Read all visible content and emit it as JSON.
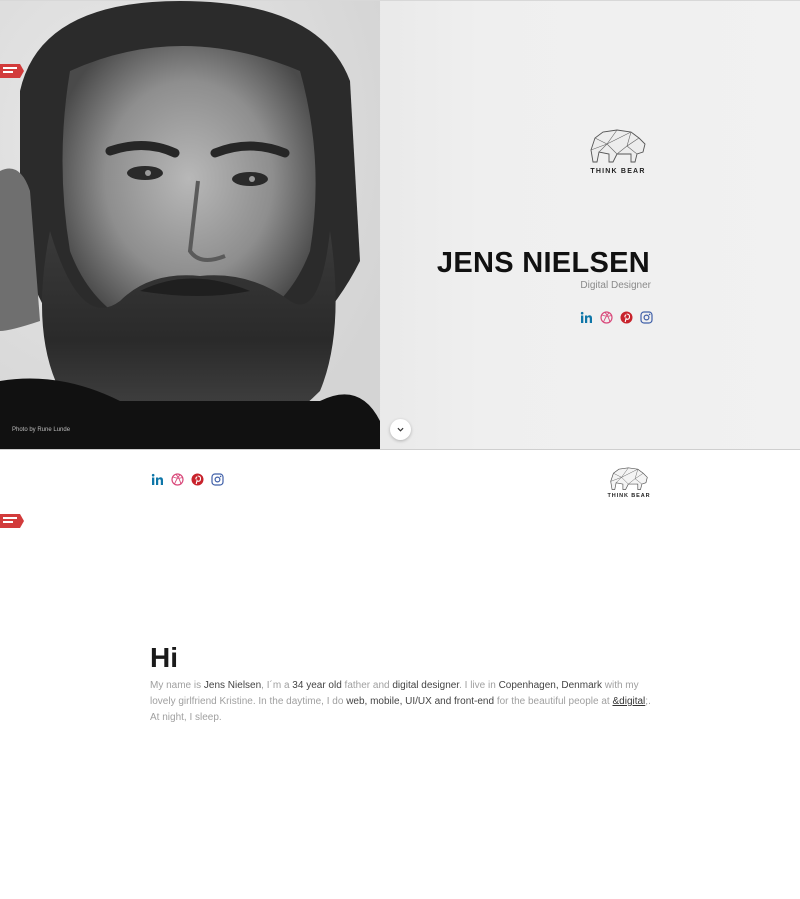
{
  "hero": {
    "name": "JENS NIELSEN",
    "role": "Digital Designer",
    "photo_credit": "Photo by Rune Lunde",
    "brand_label": "THINK BEAR"
  },
  "top_bar": {
    "brand_label": "THINK BEAR"
  },
  "social_links": [
    "linkedin",
    "dribbble",
    "pinterest",
    "instagram"
  ],
  "colors": {
    "linkedin": "#0e76a8",
    "dribbble": "#d9487a",
    "pinterest": "#c8232c",
    "instagram": "#3f5fa8",
    "award_red": "#d23b3b"
  },
  "intro": {
    "heading": "Hi",
    "p1": "My name is ",
    "name": "Jens Nielsen",
    "p2": ", I´m a ",
    "age": "34 year old",
    "p3": " father and ",
    "job": "digital designer",
    "p4": ". I live in ",
    "city": "Copenhagen, Denmark",
    "p5": " with my lovely girlfriend Kristine. In the daytime, I do ",
    "work": "web, mobile, UI/UX and front-end",
    "p6": " for the beautiful people at ",
    "company": "&digital",
    "p7": ";. At night, I sleep."
  }
}
